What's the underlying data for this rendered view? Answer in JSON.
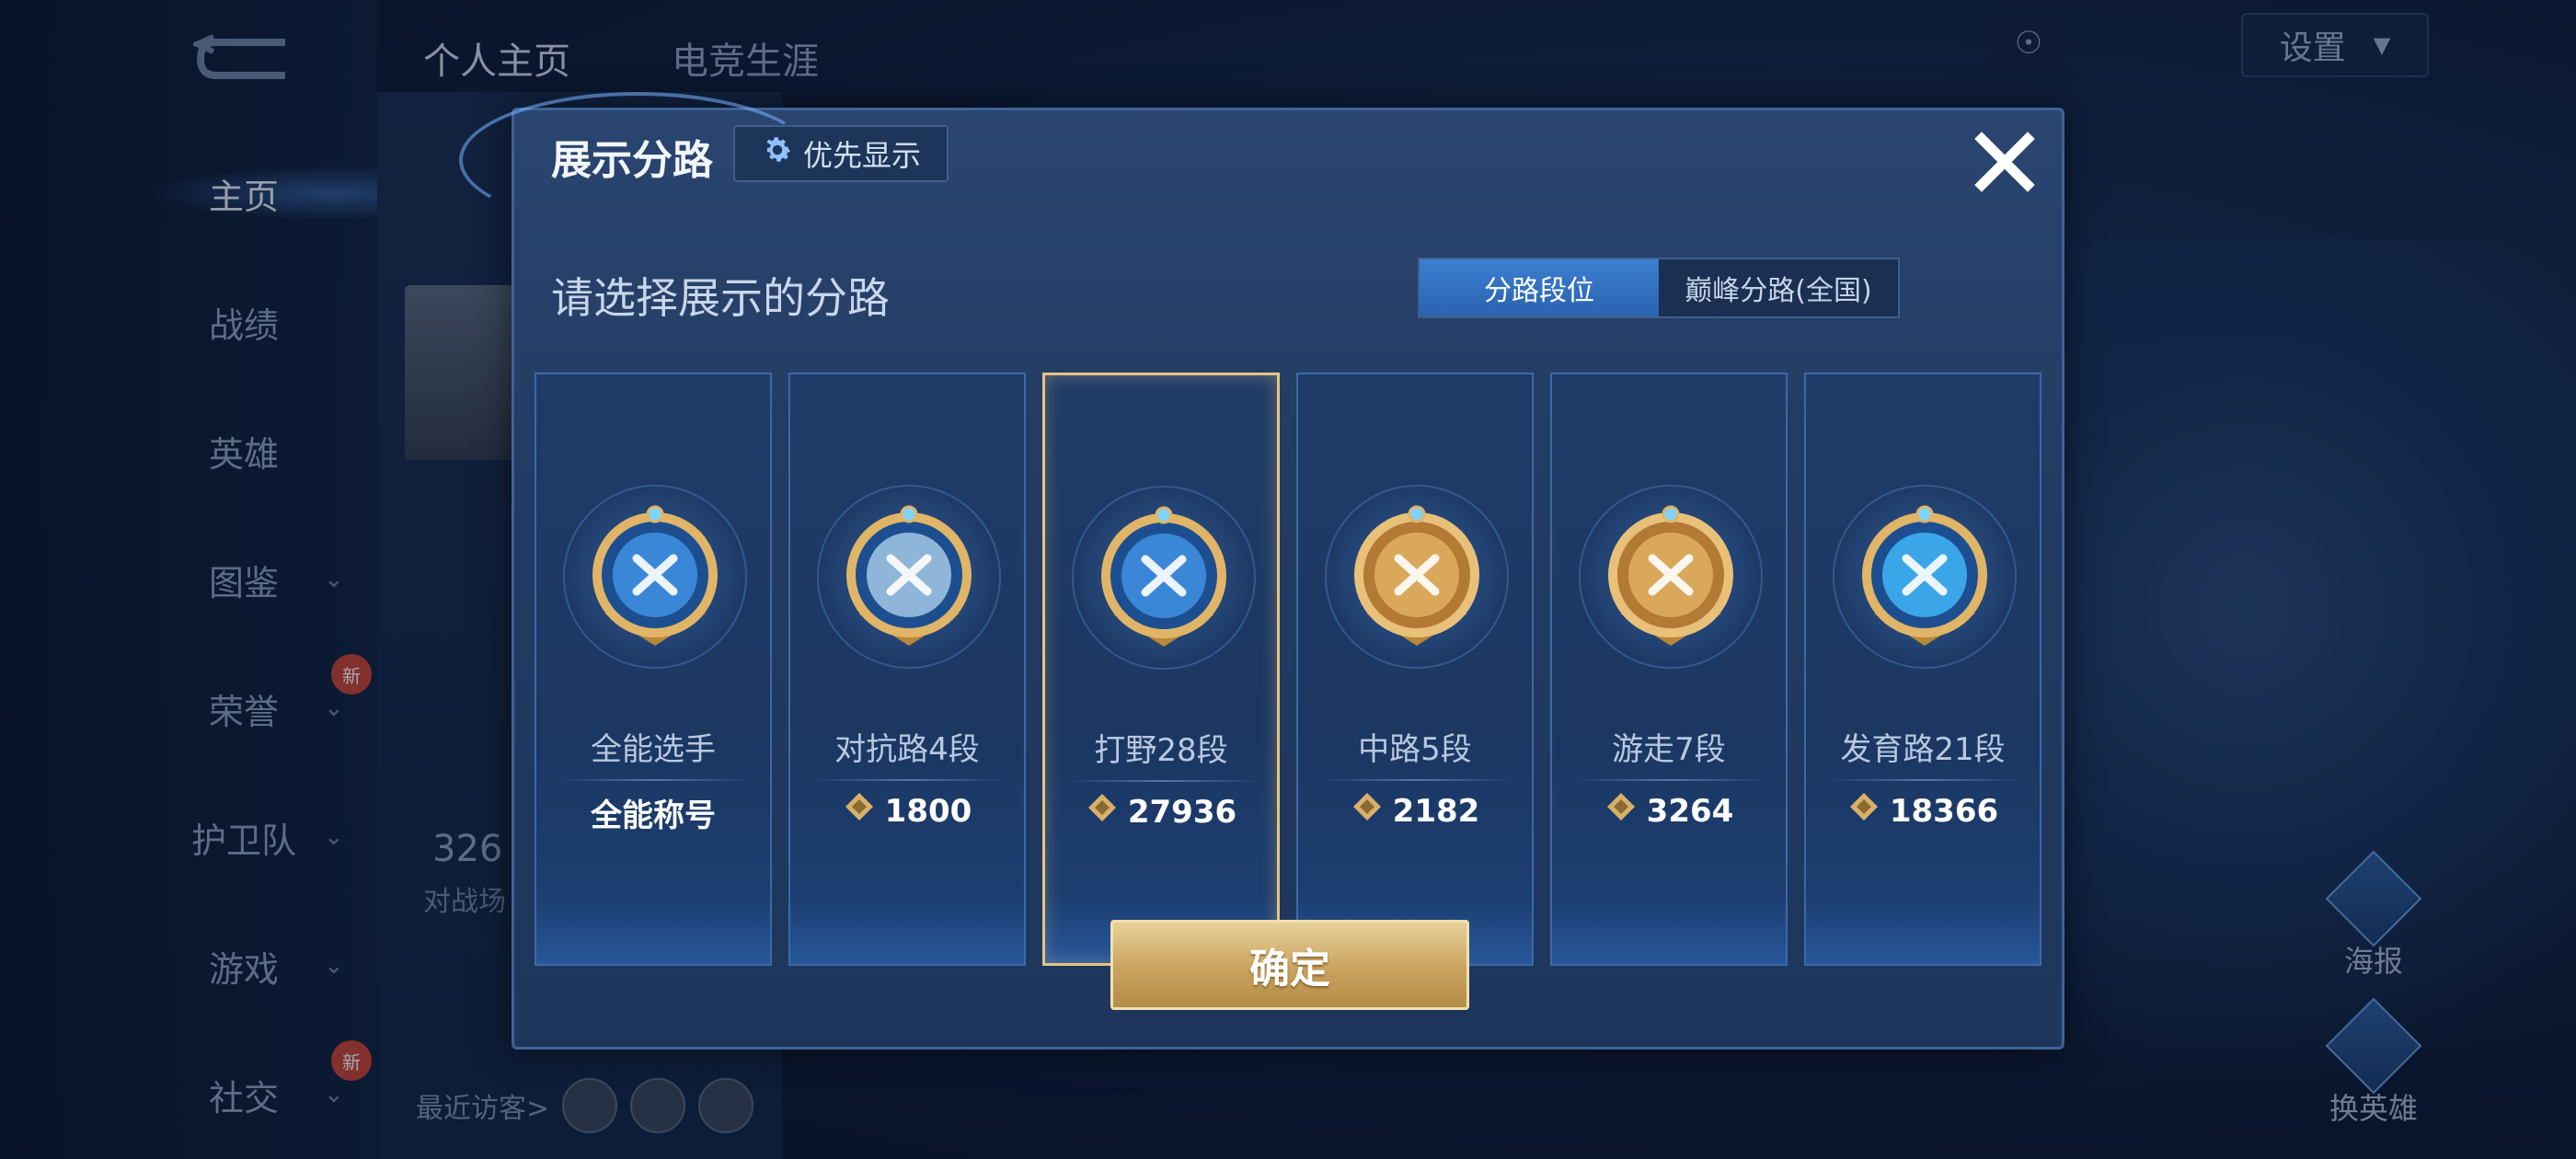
{
  "nav": {
    "items": [
      {
        "label": "主页",
        "chevron": false,
        "active": true
      },
      {
        "label": "战绩",
        "chevron": false
      },
      {
        "label": "英雄",
        "chevron": false
      },
      {
        "label": "图鉴",
        "chevron": true
      },
      {
        "label": "荣誉",
        "chevron": true,
        "badge": "新"
      },
      {
        "label": "护卫队",
        "chevron": true
      },
      {
        "label": "游戏",
        "chevron": true
      },
      {
        "label": "社交",
        "chevron": true,
        "badge": "新"
      }
    ]
  },
  "top_tabs": [
    "个人主页",
    "电竞生涯"
  ],
  "header_right": {
    "settings_label": "设置"
  },
  "background": {
    "stat_number": "326",
    "stat_sub": "对战场",
    "recent_visitors_label": "最近访客>"
  },
  "side_buttons": [
    "海报",
    "换英雄"
  ],
  "modal": {
    "title": "展示分路",
    "priority_label": "优先显示",
    "subtitle": "请选择展示的分路",
    "segments": [
      {
        "label": "分路段位",
        "active": true
      },
      {
        "label": "巅峰分路(全国)",
        "active": false
      }
    ],
    "lanes": [
      {
        "name": "全能选手",
        "value": "全能称号",
        "has_icon": false,
        "selected": false,
        "emblem": "all-round-emblem-icon",
        "color": "#3a87d8"
      },
      {
        "name": "对抗路4段",
        "value": "1800",
        "has_icon": true,
        "selected": false,
        "emblem": "clash-lane-emblem-icon",
        "color": "#8fb6d9"
      },
      {
        "name": "打野28段",
        "value": "27936",
        "has_icon": true,
        "selected": true,
        "emblem": "jungle-emblem-icon",
        "color": "#3a87d8"
      },
      {
        "name": "中路5段",
        "value": "2182",
        "has_icon": true,
        "selected": false,
        "emblem": "mid-lane-emblem-icon",
        "color": "#d9a85a"
      },
      {
        "name": "游走7段",
        "value": "3264",
        "has_icon": true,
        "selected": false,
        "emblem": "roam-emblem-icon",
        "color": "#d9a85a"
      },
      {
        "name": "发育路21段",
        "value": "18366",
        "has_icon": true,
        "selected": false,
        "emblem": "farm-lane-emblem-icon",
        "color": "#3aa6e8"
      }
    ],
    "confirm_label": "确定"
  }
}
